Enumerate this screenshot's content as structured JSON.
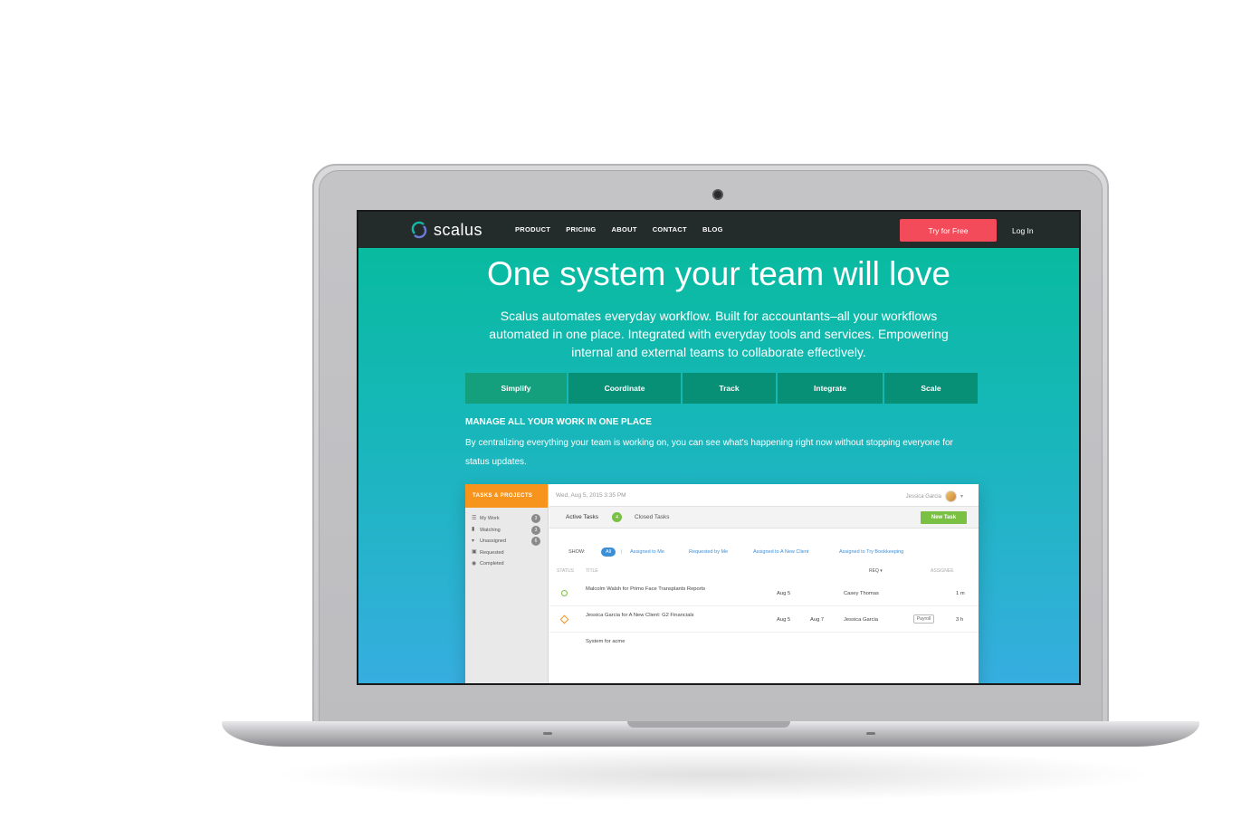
{
  "nav": {
    "logo_text": "scalus",
    "menu": [
      "PRODUCT",
      "PRICING",
      "ABOUT",
      "CONTACT",
      "BLOG"
    ],
    "cta": "Try for Free",
    "login": "Log In"
  },
  "hero": {
    "title": "One system your team will love",
    "subtitle": "Scalus automates everyday workflow. Built for accountants–all your workflows automated in one place. Integrated with everyday tools and services. Empowering internal and external teams to collaborate effectively."
  },
  "feature_tabs": [
    "Simplify",
    "Coordinate",
    "Track",
    "Integrate",
    "Scale"
  ],
  "section": {
    "title": "MANAGE ALL YOUR WORK IN ONE PLACE",
    "body": "By centralizing everything your team is working on, you can see what's happening right now without stopping everyone for status updates."
  },
  "app": {
    "sidebar_header": "TASKS & PROJECTS",
    "sidebar_items": [
      {
        "label": "My Work",
        "count": "3"
      },
      {
        "label": "Watching",
        "count": "3"
      },
      {
        "label": "Unassigned",
        "count": "6"
      },
      {
        "label": "Requested",
        "count": ""
      },
      {
        "label": "Completed",
        "count": ""
      }
    ],
    "date": "Wed, Aug 5, 2015 3:35 PM",
    "user": "Jessica Garcia",
    "tab_active": "Active Tasks",
    "tab_active_count": "4",
    "tab_closed": "Closed Tasks",
    "new_task": "New Task",
    "show_label": "SHOW:",
    "filters": [
      "All",
      "Assigned to Me",
      "Requested by Me",
      "Assigned to A New Client",
      "Assigned to Try Bookkeeping"
    ],
    "headers": {
      "status": "STATUS",
      "title": "TITLE",
      "req": "REQ ▾",
      "assignee": "ASSIGNEE"
    },
    "rows": [
      {
        "title": "Malcolm Walsh for Primo Face Transplants Reports",
        "date1": "Aug 5",
        "date2": "",
        "assignee": "Casey Thomas",
        "tag": "",
        "time": "1 m"
      },
      {
        "title": "Jessica Garcia for A New Client: G2 Financials",
        "date1": "Aug 5",
        "date2": "Aug 7",
        "assignee": "Jessica Garcia",
        "tag": "Payroll",
        "time": "3 h"
      },
      {
        "title": "System for acme",
        "date1": "",
        "date2": "",
        "assignee": "",
        "tag": "",
        "time": ""
      }
    ]
  },
  "colors": {
    "accent_teal": "#05bb9a",
    "accent_blue": "#36aee0",
    "cta_red": "#f44b5a",
    "nav_dark": "#232b2b",
    "app_orange": "#f7941d",
    "app_green": "#7ac143"
  }
}
